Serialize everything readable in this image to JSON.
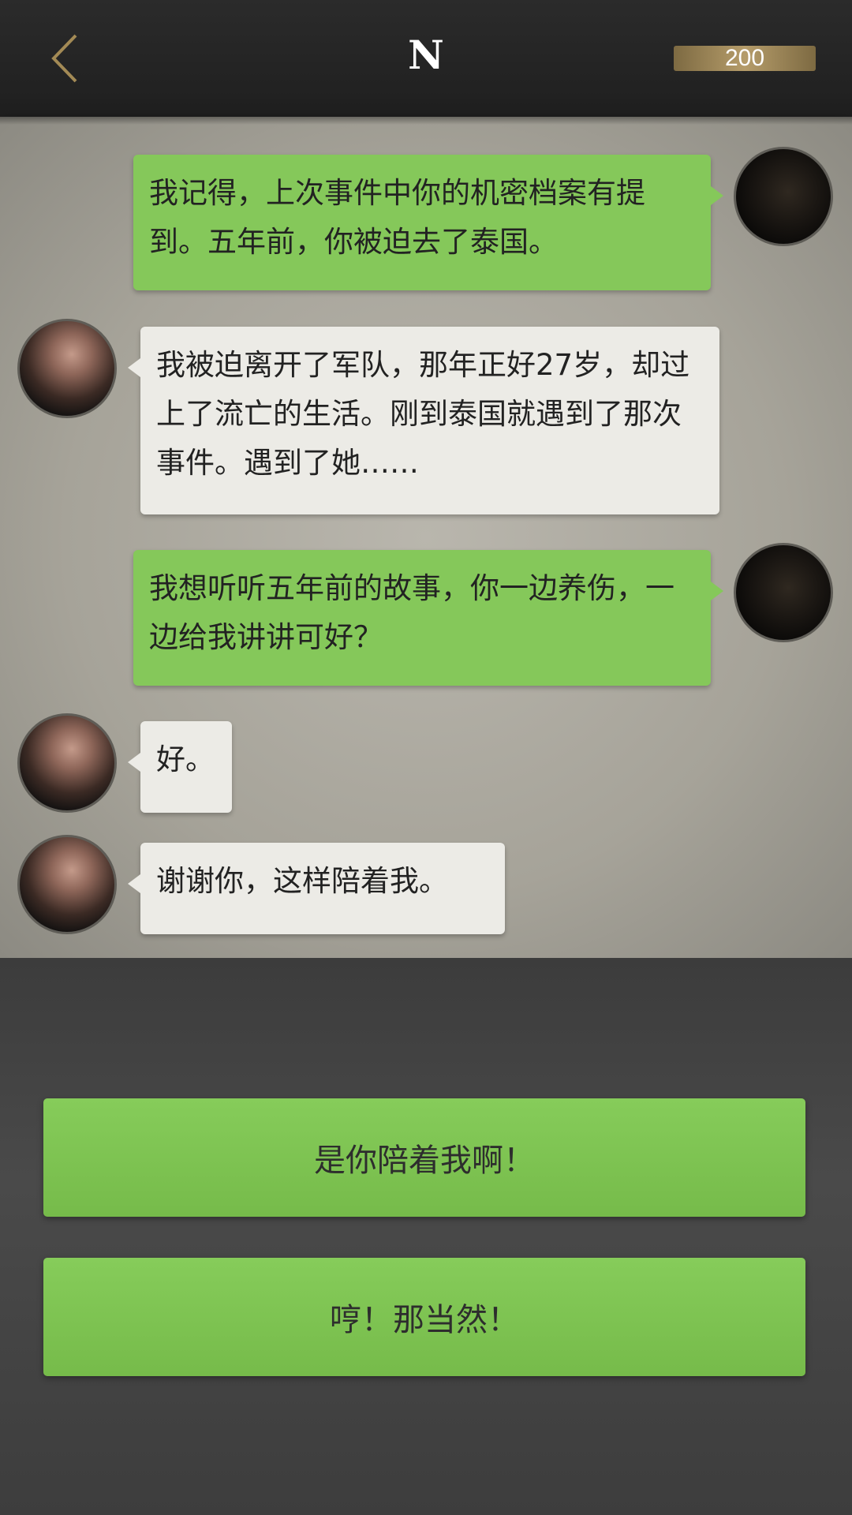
{
  "header": {
    "title": "N",
    "coins": "200",
    "back_icon": "chevron-left-icon"
  },
  "messages": [
    {
      "sender": "user",
      "text": "我记得，上次事件中你的机密档案有提到。五年前，你被迫去了泰国。"
    },
    {
      "sender": "npc",
      "text": "我被迫离开了军队，那年正好27岁，却过上了流亡的生活。刚到泰国就遇到了那次事件。遇到了她……"
    },
    {
      "sender": "user",
      "text": "我想听听五年前的故事，你一边养伤，一边给我讲讲可好？"
    },
    {
      "sender": "npc",
      "text": "好。"
    },
    {
      "sender": "npc",
      "text": "谢谢你，这样陪着我。"
    }
  ],
  "choices": [
    {
      "label": "是你陪着我啊！"
    },
    {
      "label": "哼！那当然！"
    }
  ],
  "colors": {
    "user_bubble": "#85c85a",
    "npc_bubble": "#ecebe6",
    "choice_button": "#7fc452",
    "coin_badge": "#a48d5c"
  }
}
